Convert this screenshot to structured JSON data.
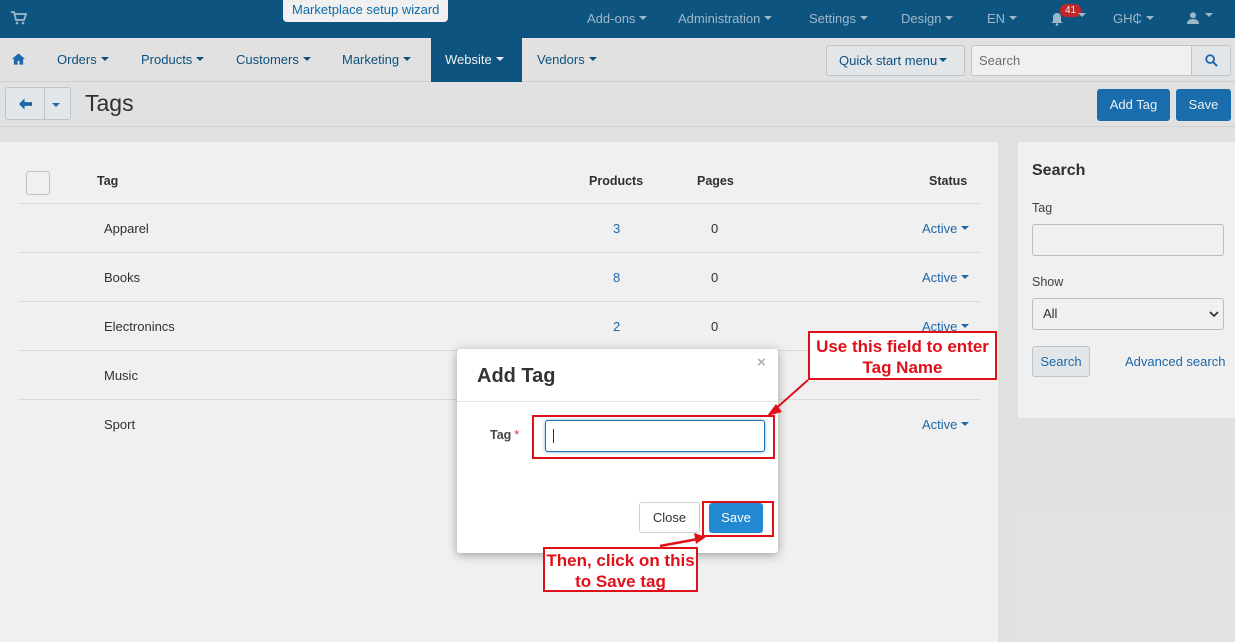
{
  "topbar": {
    "wizard_link": "Marketplace setup wizard",
    "items": [
      {
        "label": "Add-ons"
      },
      {
        "label": "Administration"
      },
      {
        "label": "Settings"
      },
      {
        "label": "Design"
      },
      {
        "label": "EN"
      },
      {
        "label": "GH₵"
      }
    ],
    "notifications_count": "41"
  },
  "mainnav": {
    "items": [
      {
        "label": "Orders"
      },
      {
        "label": "Products"
      },
      {
        "label": "Customers"
      },
      {
        "label": "Marketing"
      },
      {
        "label": "Website"
      },
      {
        "label": "Vendors"
      }
    ],
    "active": "Website",
    "quick_start": "Quick start menu",
    "search_placeholder": "Search"
  },
  "page": {
    "title": "Tags",
    "add_tag_button": "Add Tag",
    "save_button": "Save"
  },
  "table": {
    "columns": {
      "tag": "Tag",
      "products": "Products",
      "pages": "Pages",
      "status": "Status"
    },
    "rows": [
      {
        "tag": "Apparel",
        "products": "3",
        "pages": "0",
        "status": "Active"
      },
      {
        "tag": "Books",
        "products": "8",
        "pages": "0",
        "status": "Active"
      },
      {
        "tag": "Electronincs",
        "products": "2",
        "pages": "0",
        "status": "Active"
      },
      {
        "tag": "Music",
        "products": "",
        "pages": "",
        "status": ""
      },
      {
        "tag": "Sport",
        "products": "",
        "pages": "",
        "status": "Active"
      }
    ]
  },
  "sidebar": {
    "title": "Search",
    "tag_label": "Tag",
    "show_label": "Show",
    "show_value": "All",
    "search_button": "Search",
    "advanced_search": "Advanced search"
  },
  "modal": {
    "title": "Add Tag",
    "close_x": "×",
    "tag_label": "Tag",
    "required_mark": "*",
    "tag_value": "",
    "close_button": "Close",
    "save_button": "Save"
  },
  "annotations": {
    "callout_field": "Use this field to enter Tag Name",
    "callout_save": "Then, click on this to Save tag",
    "color": "#e0101a"
  }
}
